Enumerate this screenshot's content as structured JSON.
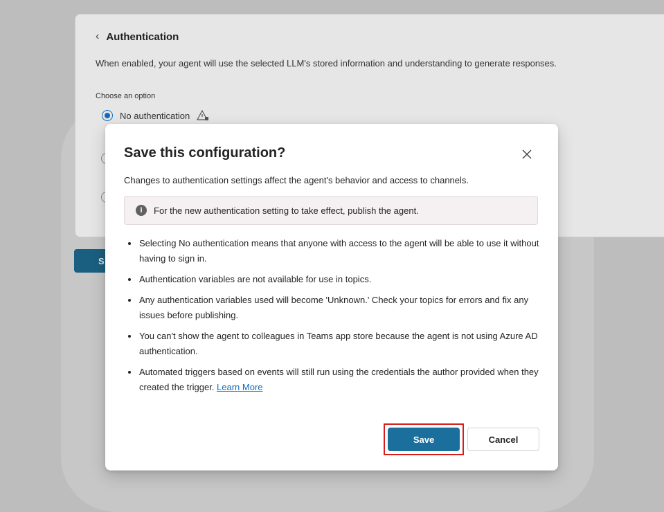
{
  "background": {
    "title": "Authentication",
    "description": "When enabled, your agent will use the selected LLM's stored information and understanding to generate responses.",
    "choose_label": "Choose an option",
    "selected_option": "No authentication",
    "save_stub": "S"
  },
  "dialog": {
    "title": "Save this configuration?",
    "subtitle": "Changes to authentication settings affect the agent's behavior and access to channels.",
    "info": "For the new authentication setting to take effect, publish the agent.",
    "bullets": [
      "Selecting No authentication means that anyone with access to the agent will be able to use it without having to sign in.",
      "Authentication variables are not available for use in topics.",
      "Any authentication variables used will become 'Unknown.' Check your topics for errors and fix any issues before publishing.",
      "You can't show the agent to colleagues in Teams app store because the agent is not using Azure AD authentication.",
      "Automated triggers based on events will still run using the credentials the author provided when they created the trigger."
    ],
    "learn_more": "Learn More",
    "save_label": "Save",
    "cancel_label": "Cancel"
  },
  "colors": {
    "accent": "#0f6cbd",
    "save_button": "#1a6f9c",
    "highlight": "#d81b1b"
  }
}
